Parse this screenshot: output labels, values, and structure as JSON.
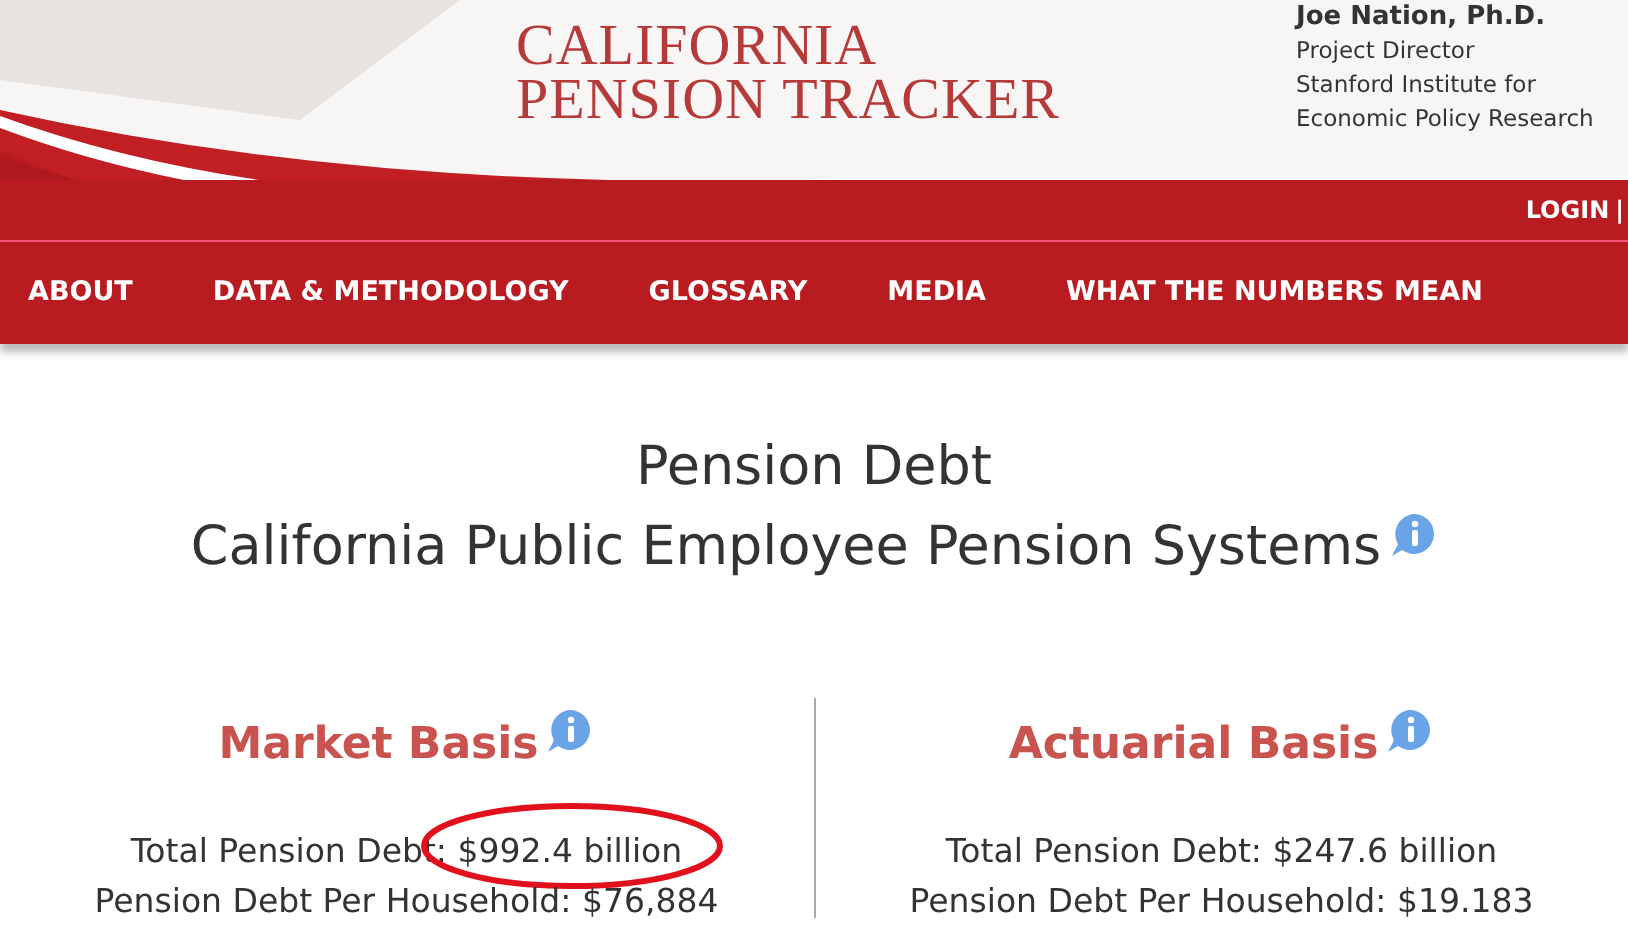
{
  "header": {
    "title_lines": [
      "CALIFORNIA",
      "PENSION TRACKER"
    ],
    "author": {
      "name": "Joe Nation, Ph.D.",
      "lines": [
        "Project Director",
        "Stanford Institute for",
        "Economic Policy Research"
      ]
    }
  },
  "topbar": {
    "login": "LOGIN",
    "separator": "|"
  },
  "nav": [
    "ABOUT",
    "DATA & METHODOLOGY",
    "GLOSSARY",
    "MEDIA",
    "WHAT THE NUMBERS MEAN"
  ],
  "page_title": [
    "Pension Debt",
    "California Public Employee Pension Systems"
  ],
  "sections": [
    {
      "heading": "Market Basis",
      "stats": [
        {
          "text": "Total Pension Debt: $992.4 billion",
          "highlighted": true
        },
        {
          "text": "Pension Debt Per Household: $76,884",
          "highlighted": false
        }
      ]
    },
    {
      "heading": "Actuarial Basis",
      "stats": [
        {
          "text": "Total Pension Debt: $247.6 billion",
          "highlighted": false
        },
        {
          "text": "Pension Debt Per Household: $19.183",
          "highlighted": false
        }
      ]
    }
  ]
}
